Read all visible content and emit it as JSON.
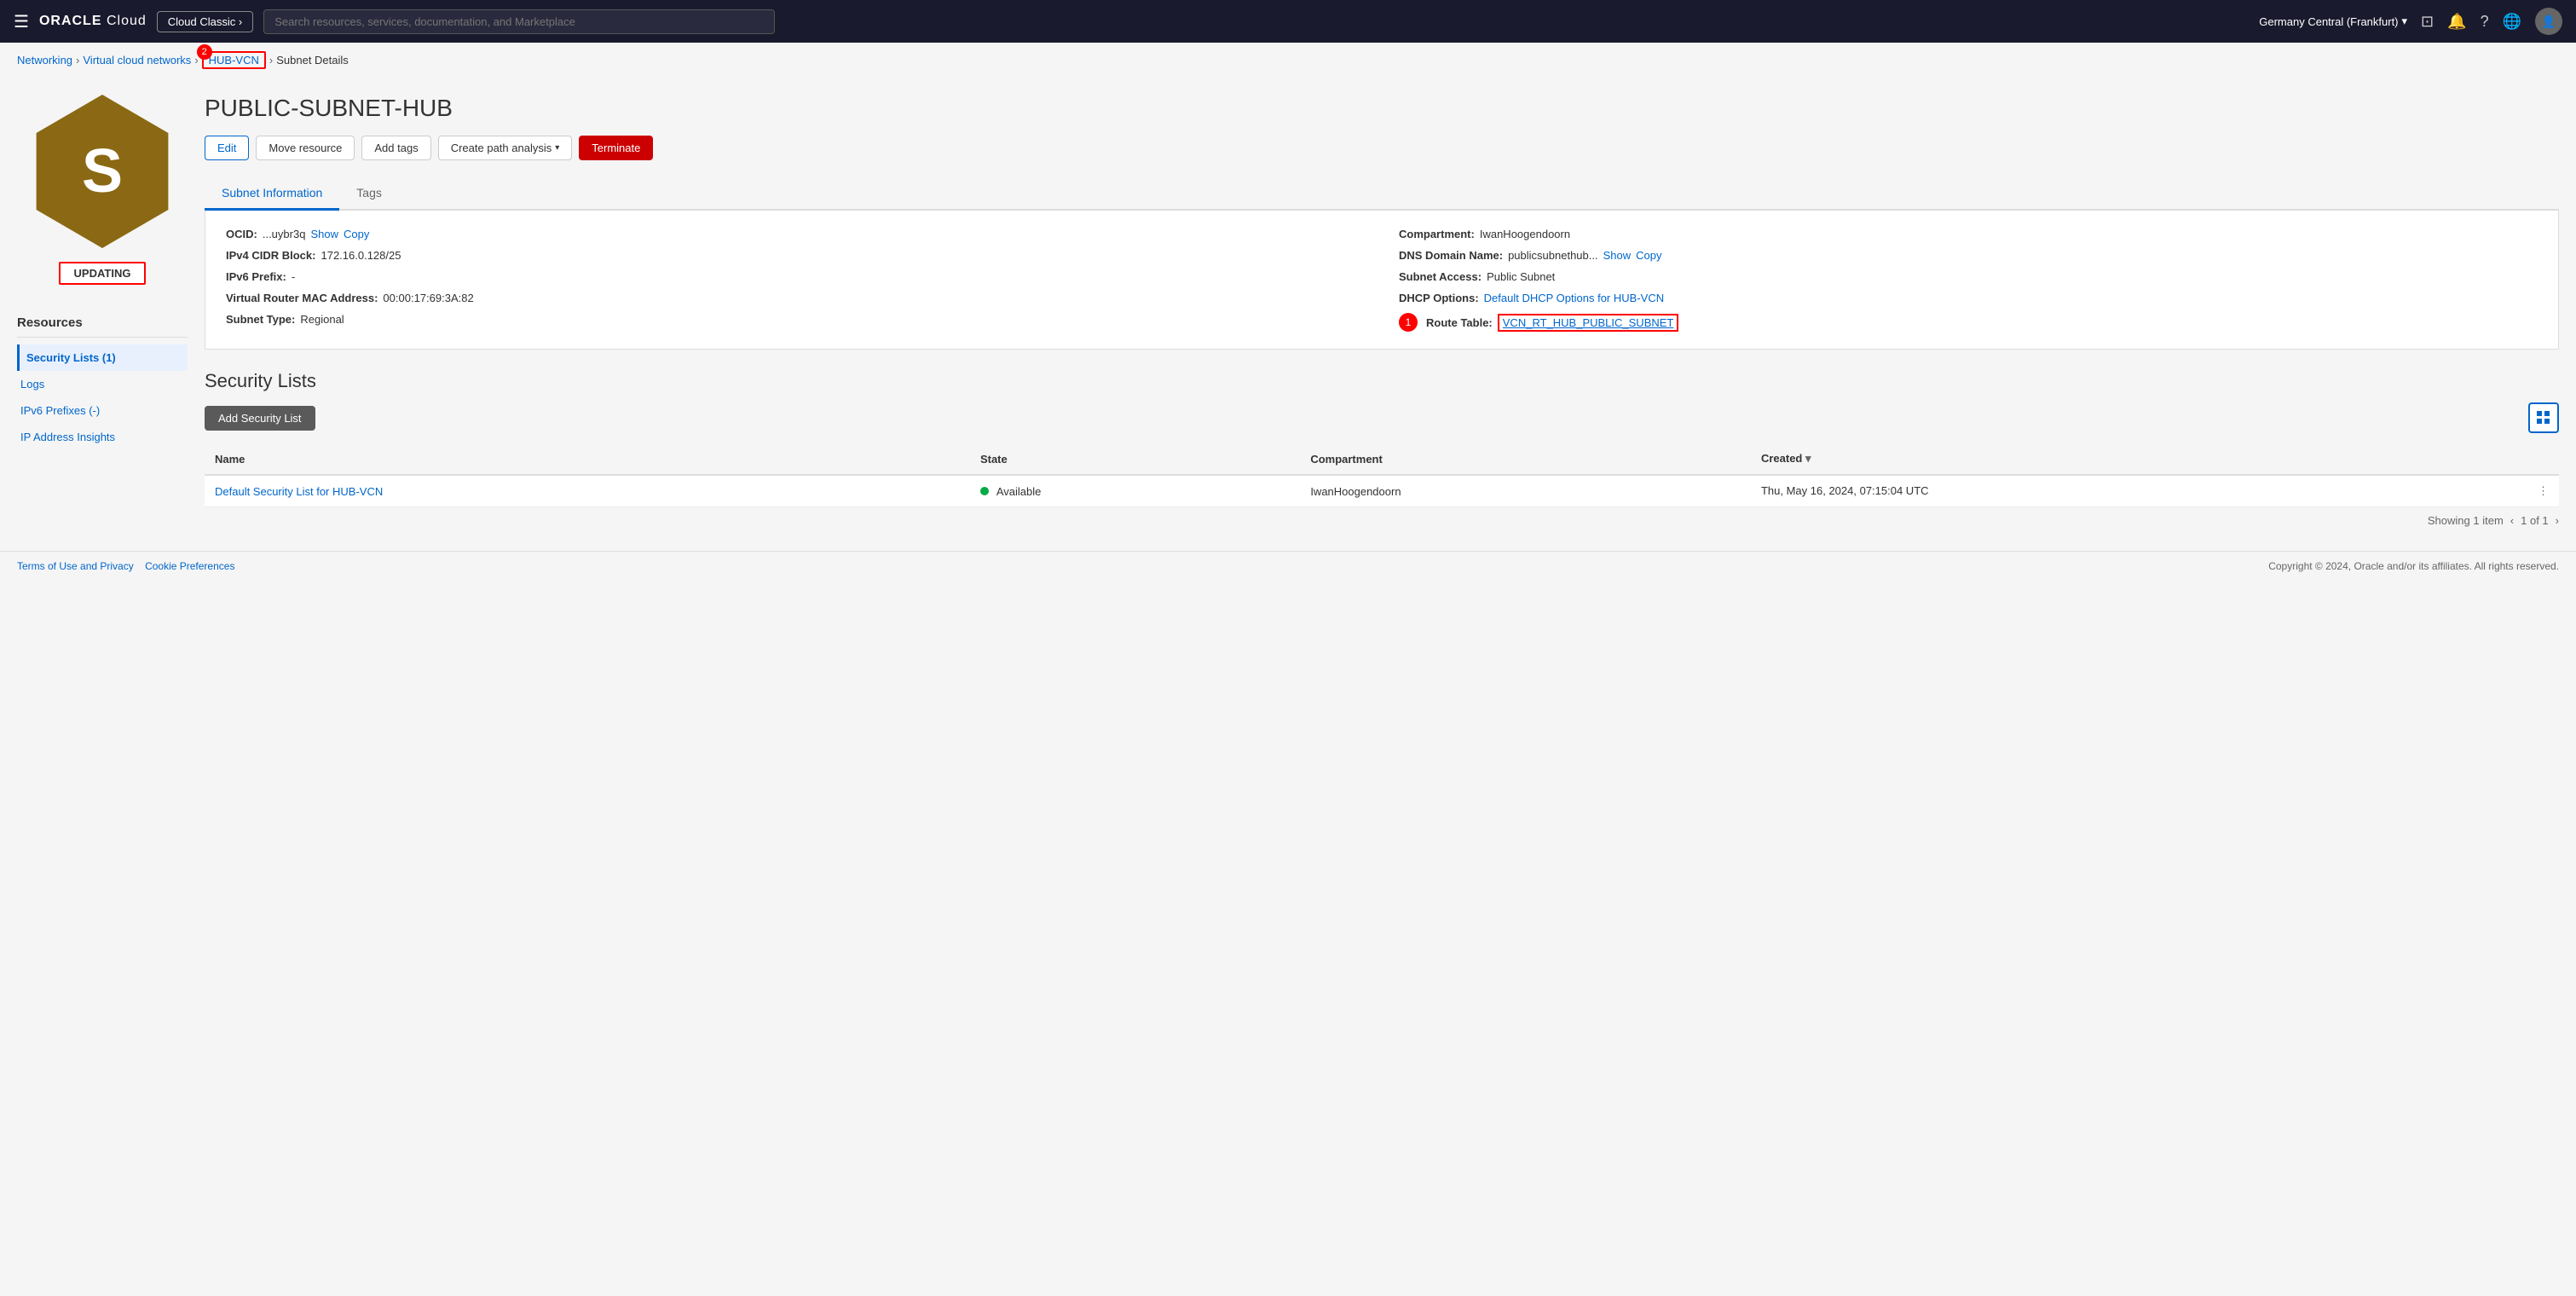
{
  "topnav": {
    "logo": "ORACLE",
    "logo_sub": "Cloud",
    "cloud_classic_label": "Cloud Classic ›",
    "search_placeholder": "Search resources, services, documentation, and Marketplace",
    "region": "Germany Central (Frankfurt)",
    "region_caret": "▾"
  },
  "breadcrumb": {
    "networking": "Networking",
    "virtual_cloud_networks": "Virtual cloud networks",
    "hub_vcn": "HUB-VCN",
    "hub_vcn_badge": "2",
    "subnet_details": "Subnet Details"
  },
  "page": {
    "title": "PUBLIC-SUBNET-HUB",
    "status": "UPDATING"
  },
  "buttons": {
    "edit": "Edit",
    "move_resource": "Move resource",
    "add_tags": "Add tags",
    "create_path_analysis": "Create path analysis",
    "terminate": "Terminate"
  },
  "tabs": {
    "subnet_information": "Subnet Information",
    "tags": "Tags"
  },
  "subnet_info": {
    "ocid_label": "OCID:",
    "ocid_value": "...uybr3q",
    "ocid_show": "Show",
    "ocid_copy": "Copy",
    "ipv4_cidr_label": "IPv4 CIDR Block:",
    "ipv4_cidr_value": "172.16.0.128/25",
    "ipv6_prefix_label": "IPv6 Prefix:",
    "ipv6_prefix_value": "-",
    "virtual_router_mac_label": "Virtual Router MAC Address:",
    "virtual_router_mac_value": "00:00:17:69:3A:82",
    "subnet_type_label": "Subnet Type:",
    "subnet_type_value": "Regional",
    "compartment_label": "Compartment:",
    "compartment_value": "IwanHoogendoorn",
    "dns_domain_label": "DNS Domain Name:",
    "dns_domain_value": "publicsubnethub...",
    "dns_show": "Show",
    "dns_copy": "Copy",
    "subnet_access_label": "Subnet Access:",
    "subnet_access_value": "Public Subnet",
    "dhcp_options_label": "DHCP Options:",
    "dhcp_options_link": "Default DHCP Options for HUB-VCN",
    "route_table_label": "Route Table:",
    "route_table_link": "VCN_RT_HUB_PUBLIC_SUBNET",
    "badge_1": "1"
  },
  "resources": {
    "title": "Resources",
    "items": [
      {
        "id": "security-lists",
        "label": "Security Lists (1)",
        "active": true
      },
      {
        "id": "logs",
        "label": "Logs",
        "active": false
      },
      {
        "id": "ipv6-prefixes",
        "label": "IPv6 Prefixes (-)",
        "active": false
      },
      {
        "id": "ip-address-insights",
        "label": "IP Address Insights",
        "active": false
      }
    ]
  },
  "security_lists": {
    "title": "Security Lists",
    "add_button": "Add Security List",
    "table": {
      "columns": [
        "Name",
        "State",
        "Compartment",
        "Created"
      ],
      "rows": [
        {
          "name": "Default Security List for HUB-VCN",
          "name_link": true,
          "state": "Available",
          "state_dot": true,
          "compartment": "IwanHoogendoorn",
          "created": "Thu, May 16, 2024, 07:15:04 UTC"
        }
      ]
    },
    "footer": "Showing 1 item",
    "pagination": "1 of 1"
  },
  "footer": {
    "terms": "Terms of Use and Privacy",
    "cookie": "Cookie Preferences",
    "copyright": "Copyright © 2024, Oracle and/or its affiliates. All rights reserved."
  }
}
